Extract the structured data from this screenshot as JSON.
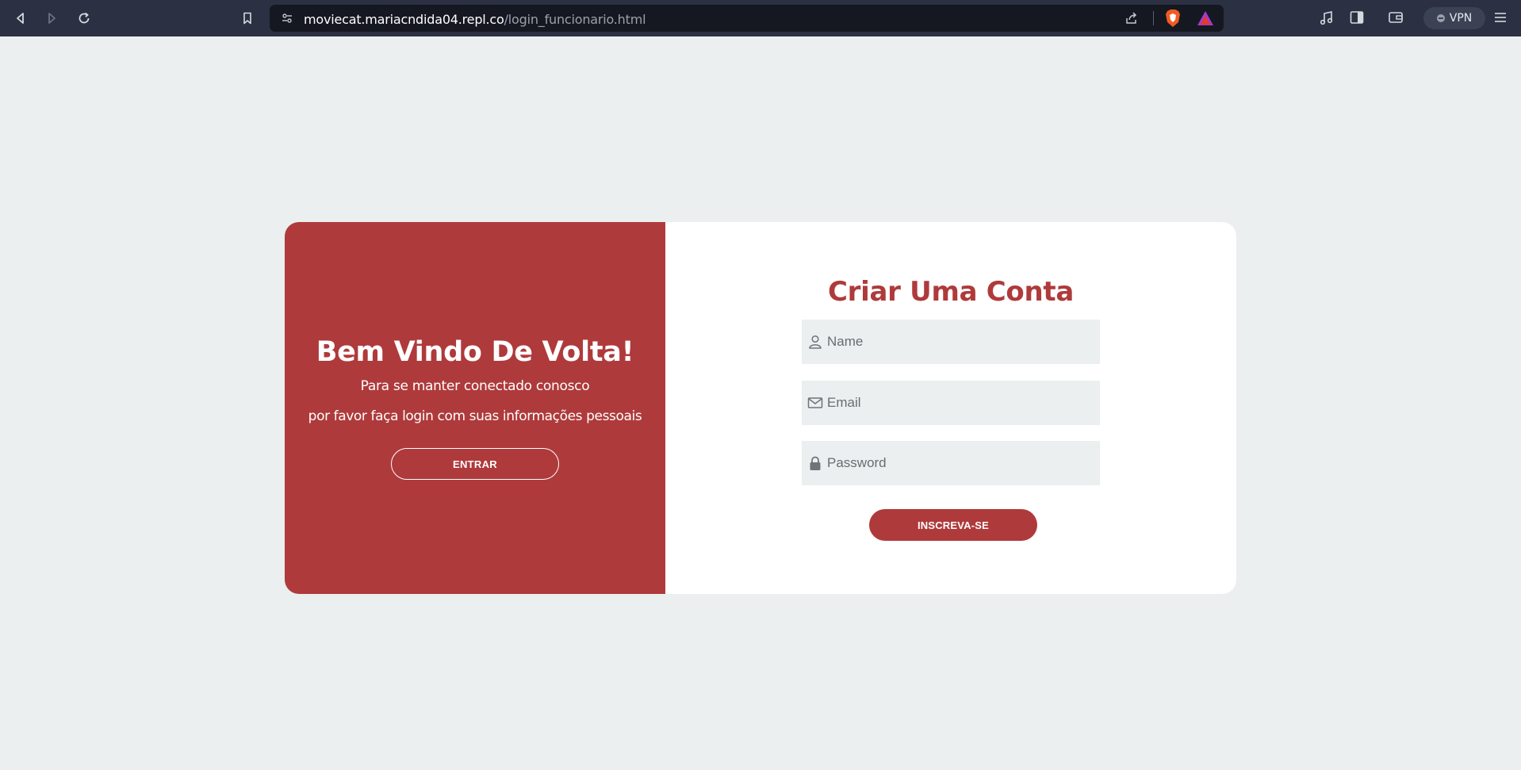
{
  "browser": {
    "url_host": "moviecat.mariacndida04.repl.co",
    "url_path": "/login_funcionario.html",
    "vpn_label": "VPN"
  },
  "welcome_panel": {
    "title": "Bem Vindo De Volta!",
    "line1": "Para se manter conectado conosco",
    "line2": "por favor faça login com suas informações pessoais",
    "button_label": "ENTRAR"
  },
  "signup_form": {
    "title": "Criar Uma Conta",
    "name_placeholder": "Name",
    "email_placeholder": "Email",
    "password_placeholder": "Password",
    "button_label": "INSCREVA-SE"
  },
  "colors": {
    "brand": "#af3a3b",
    "page_bg": "#ebeff0",
    "browser_bar": "#2b3142"
  }
}
